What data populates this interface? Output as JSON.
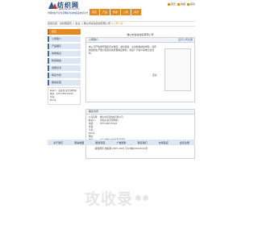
{
  "logo": {
    "title": "纺织网",
    "url": "www.tianzhi.com.cn",
    "slogan": "中国纺织行业专业网站  各种纺织品交易平台"
  },
  "topnav": [
    "首页",
    "产品",
    "供求",
    "公司",
    "商讯"
  ],
  "toplinks": [
    "首页",
    "收藏",
    "联系"
  ],
  "breadcrumb": {
    "trail": "您的位置：纺织网首页 > 企业 > 佛山市某某纺织有限公司 >",
    "current": "公司介绍"
  },
  "sidebar": {
    "items": [
      "首页",
      "公司简介",
      "产品展示",
      "供求信息",
      "新闻动态",
      "资质证书",
      "联系方式",
      "留言反馈"
    ],
    "contact": [
      "联系人：某先生(业务部经理)",
      "电话：0757-8877XXXX",
      "传真：",
      "Email："
    ]
  },
  "main": {
    "company_title": "佛山市某某纺织有限公司",
    "intro_header": "公司简介",
    "intro_more_link": "显示公司全部",
    "intro_text": "本公司严格遵守国家有关规定，诚信经营，主营各类纺织布料，具有较强的生产能力和完善的质量保证体系，欢迎广大客户来电洽谈合作。",
    "intro_more": "更多",
    "contact_header": "联系方式",
    "contact_rows": [
      {
        "k": "公司名称：",
        "v": "佛山市某某纺织有限公司"
      },
      {
        "k": "联系人：",
        "v": "某先生(业务部经理)"
      },
      {
        "k": "电话：",
        "v": "0757-8877XXXX"
      },
      {
        "k": "传真：",
        "v": ""
      },
      {
        "k": "手机：",
        "v": ""
      },
      {
        "k": "Email：",
        "v": ""
      },
      {
        "k": "网址：",
        "v": ""
      },
      {
        "k": "地址：",
        "v": "广东省佛山市南海区某某镇"
      },
      {
        "k": "邮编：",
        "v": "528000"
      }
    ]
  },
  "footer": {
    "links": [
      "关于我们",
      "网站地图",
      "服务项目",
      "广告服务",
      "联系我们",
      "友情链接",
      "会员注册"
    ],
    "copyright": "版权所有 纺织网 2007-2015  京ICP备XXXXXXXX号"
  },
  "watermark": {
    "text": "攻收录"
  }
}
